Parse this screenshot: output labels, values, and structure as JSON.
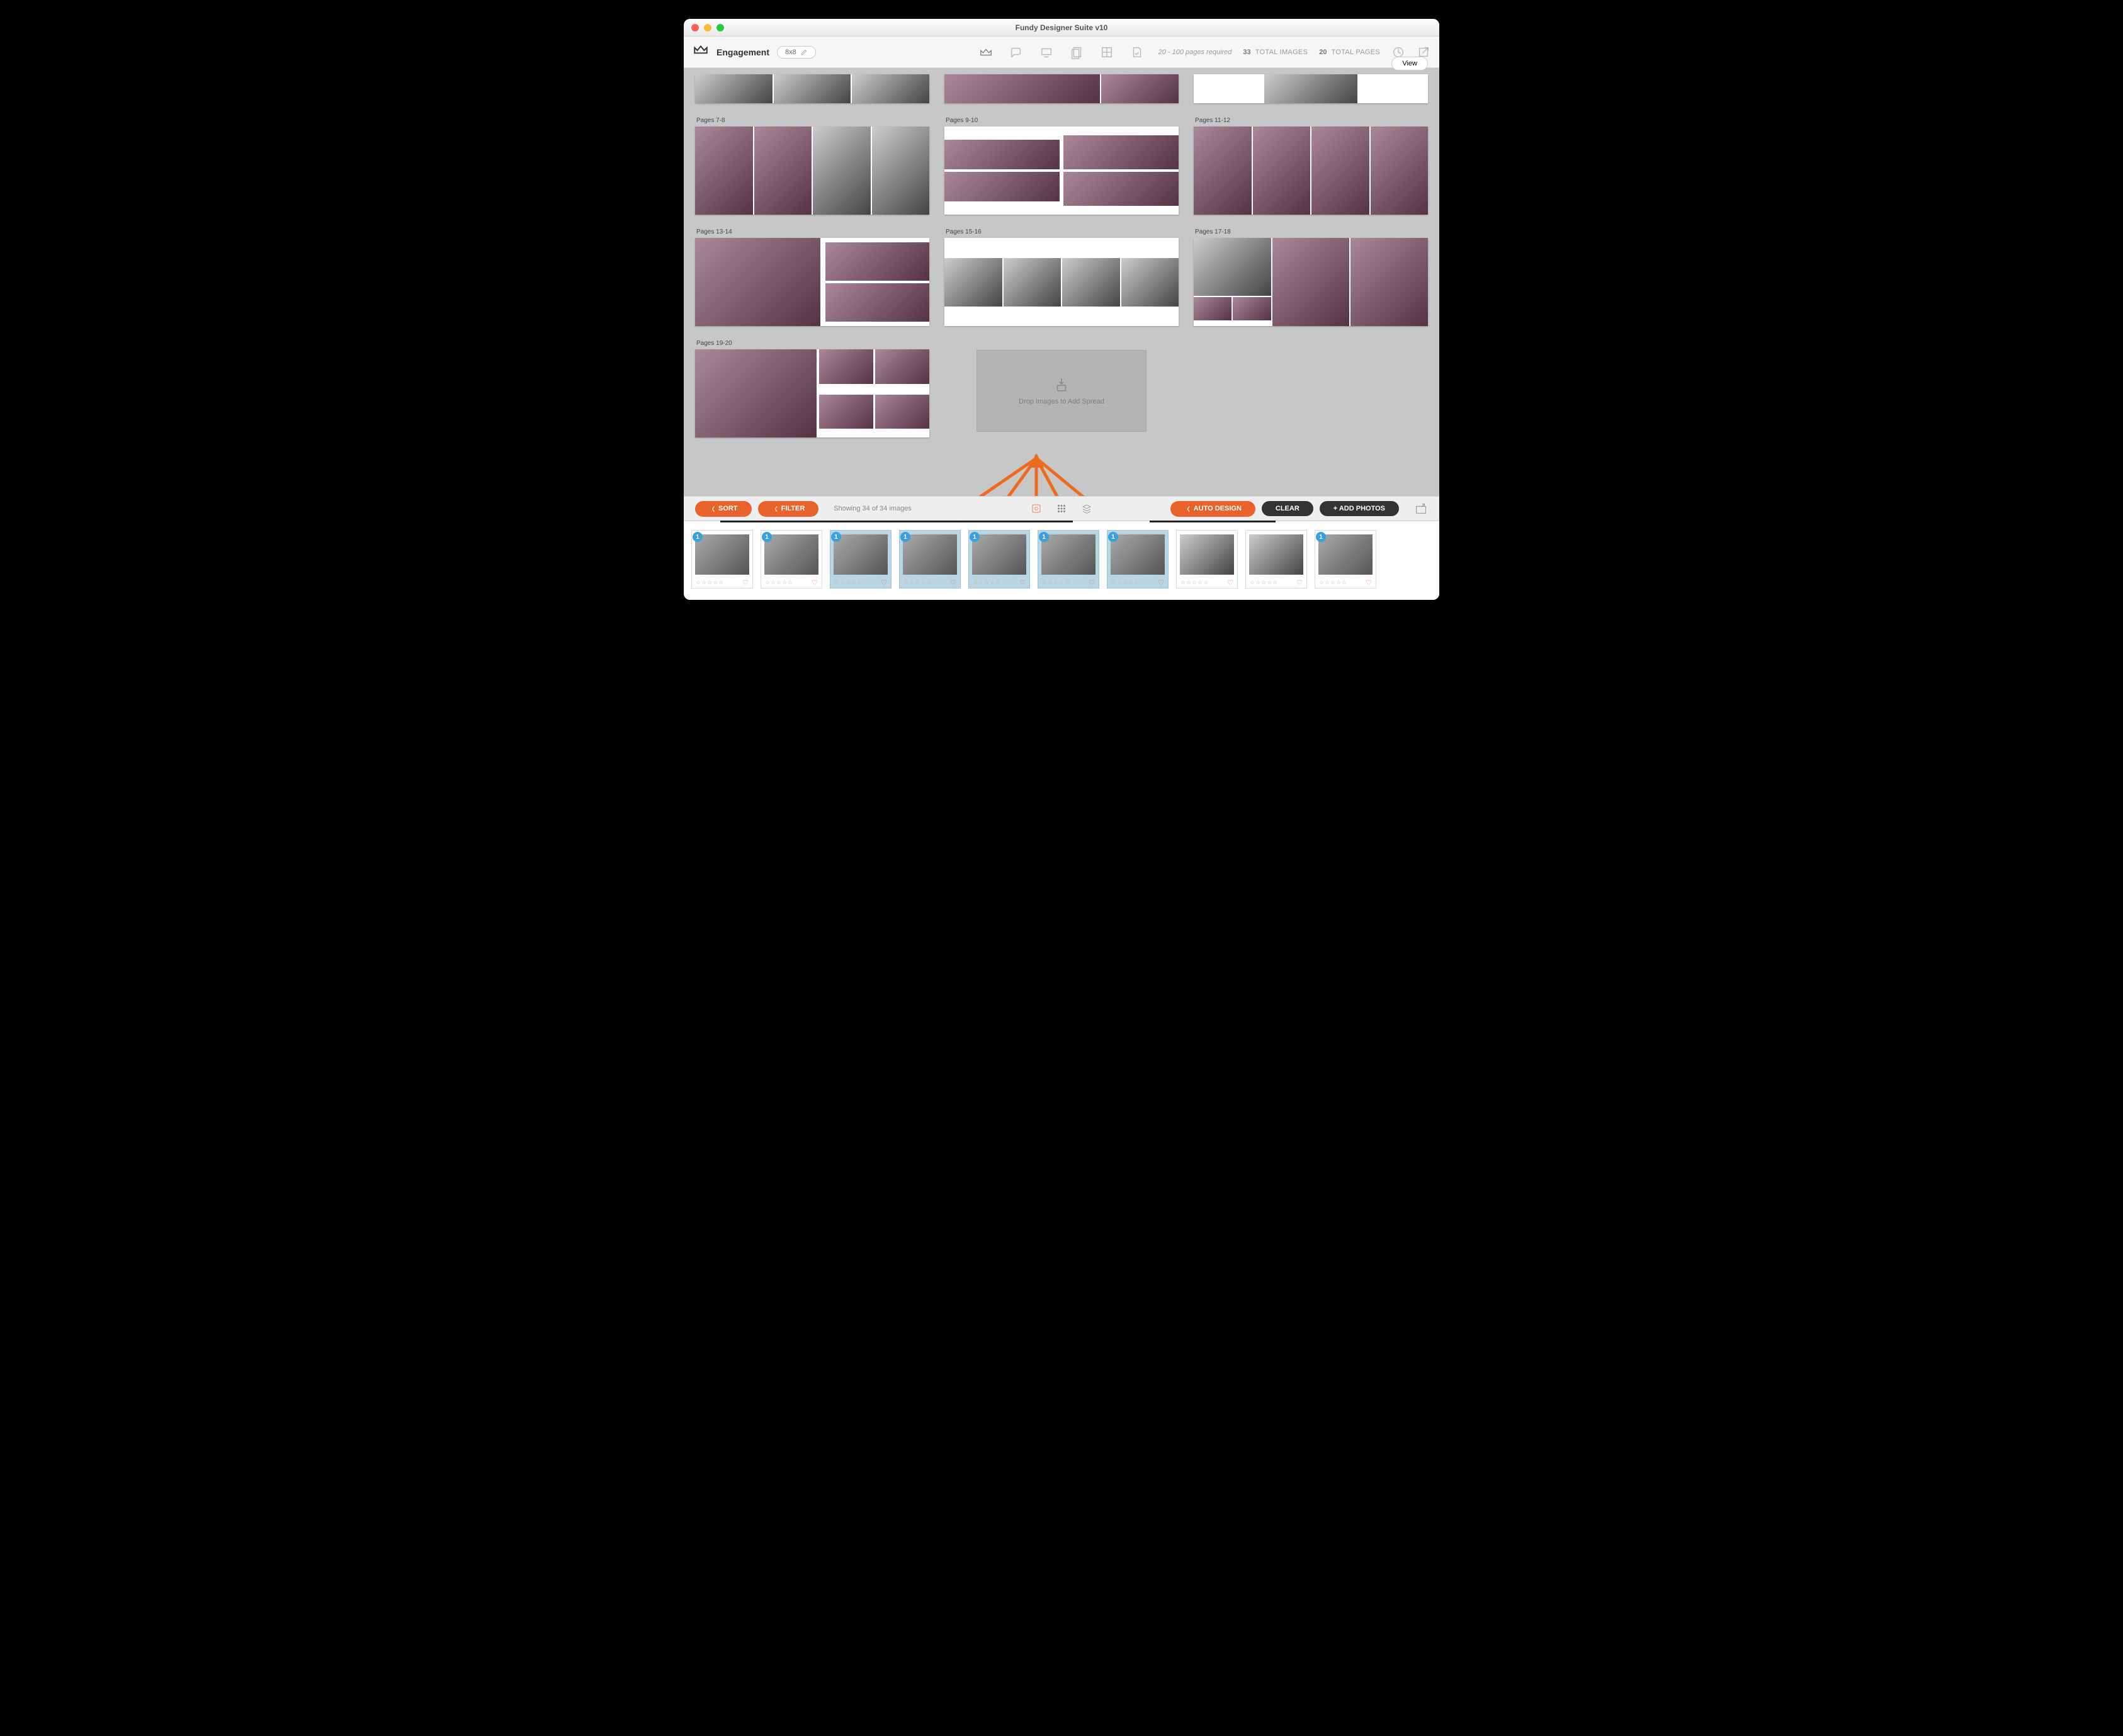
{
  "title": "Fundy Designer Suite v10",
  "project": {
    "name": "Engagement",
    "size": "8x8"
  },
  "toolbar": {
    "pages_required": "20 - 100 pages required",
    "total_images": {
      "count": "33",
      "label": "TOTAL IMAGES"
    },
    "total_pages": {
      "count": "20",
      "label": "TOTAL PAGES"
    },
    "view_label": "View"
  },
  "spreads": [
    {
      "label": "",
      "row0": true
    },
    {
      "label": "",
      "row0": true
    },
    {
      "label": "",
      "row0": true
    },
    {
      "label": "Pages 7-8"
    },
    {
      "label": "Pages 9-10"
    },
    {
      "label": "Pages 11-12"
    },
    {
      "label": "Pages 13-14"
    },
    {
      "label": "Pages 15-16"
    },
    {
      "label": "Pages 17-18"
    },
    {
      "label": "Pages 19-20"
    }
  ],
  "dropzone": {
    "text": "Drop Images to Add Spread"
  },
  "actionbar": {
    "sort": "SORT",
    "filter": "FILTER",
    "status": "Showing 34 of 34 images",
    "auto_design": "AUTO DESIGN",
    "clear": "CLEAR",
    "add_photos": "+ ADD PHOTOS"
  },
  "well": {
    "items": [
      {
        "badge": "1",
        "selected": false,
        "bw": false
      },
      {
        "badge": "1",
        "selected": false,
        "bw": false
      },
      {
        "badge": "1",
        "selected": true,
        "bw": false
      },
      {
        "badge": "1",
        "selected": true,
        "bw": false
      },
      {
        "badge": "1",
        "selected": true,
        "bw": false
      },
      {
        "badge": "1",
        "selected": true,
        "bw": false
      },
      {
        "badge": "1",
        "selected": true,
        "bw": false
      },
      {
        "badge": "",
        "selected": false,
        "bw": true
      },
      {
        "badge": "",
        "selected": false,
        "bw": true
      },
      {
        "badge": "1",
        "selected": false,
        "bw": false
      }
    ],
    "stars_glyph": "☆☆☆☆☆",
    "heart_glyph": "♡"
  }
}
